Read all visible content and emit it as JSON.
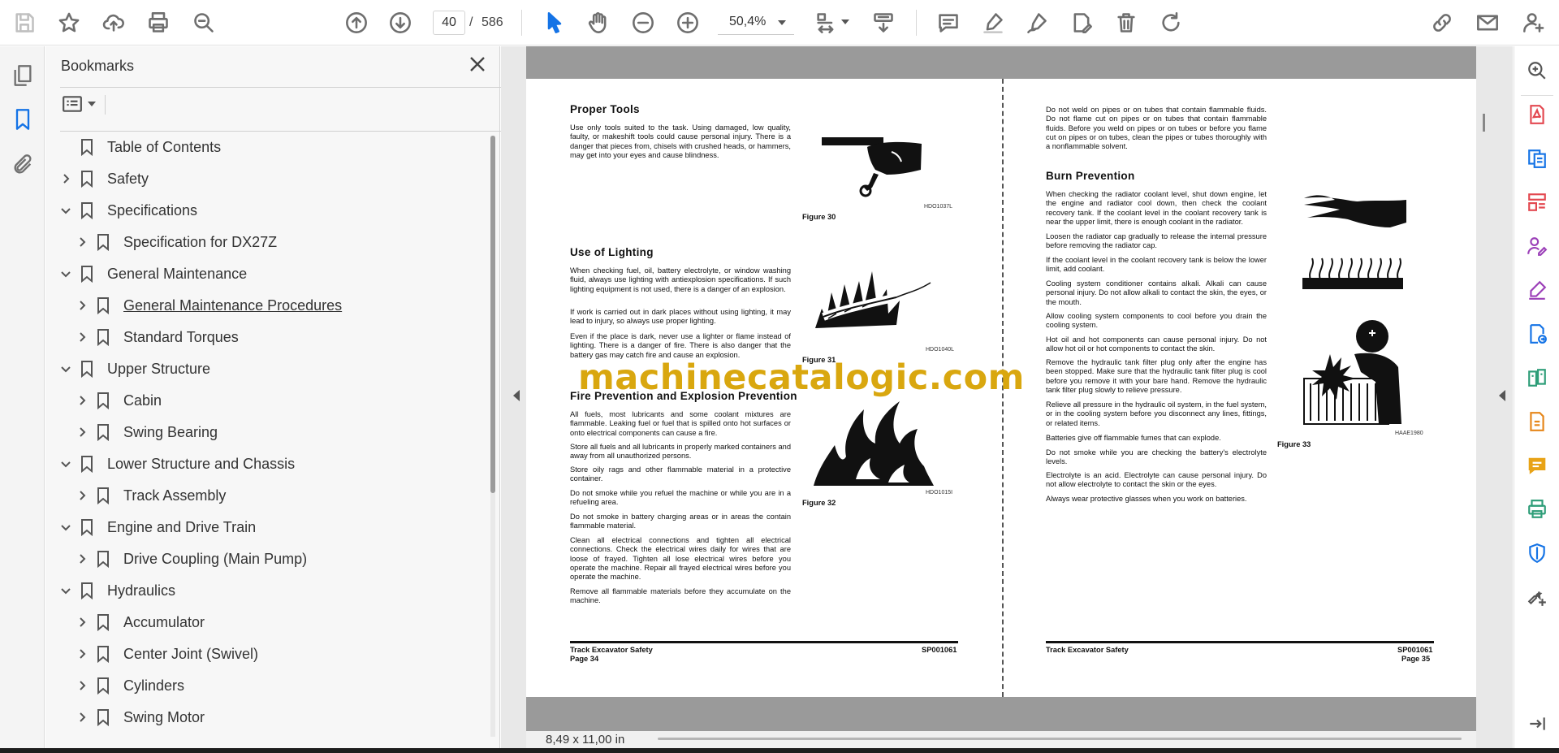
{
  "toolbar": {
    "page_current": "40",
    "page_separator": "/",
    "page_total": "586",
    "zoom": "50,4%",
    "icons": [
      "save-icon",
      "star-icon",
      "upload-icon",
      "print-icon",
      "zoom-search-icon",
      "page-up-icon",
      "page-down-icon",
      "select-arrow-icon",
      "hand-icon",
      "zoom-out-icon",
      "zoom-in-icon",
      "fit-page-icon",
      "scroll-mode-icon",
      "comment-icon",
      "highlight-icon",
      "sign-icon",
      "edit-pdf-icon",
      "delete-icon",
      "rotate-icon",
      "share-link-icon",
      "mail-icon",
      "add-user-icon"
    ]
  },
  "bookmarks": {
    "title": "Bookmarks",
    "items": [
      {
        "label": "Table of Contents",
        "level": 0,
        "chevron": "none"
      },
      {
        "label": "Safety",
        "level": 0,
        "chevron": "right"
      },
      {
        "label": "Specifications",
        "level": 0,
        "chevron": "down"
      },
      {
        "label": "Specification for DX27Z",
        "level": 1,
        "chevron": "right"
      },
      {
        "label": "General Maintenance",
        "level": 0,
        "chevron": "down"
      },
      {
        "label": "General Maintenance Procedures",
        "level": 1,
        "chevron": "right",
        "hover": true
      },
      {
        "label": "Standard Torques",
        "level": 1,
        "chevron": "right"
      },
      {
        "label": "Upper Structure",
        "level": 0,
        "chevron": "down"
      },
      {
        "label": "Cabin",
        "level": 1,
        "chevron": "right"
      },
      {
        "label": "Swing Bearing",
        "level": 1,
        "chevron": "right"
      },
      {
        "label": "Lower Structure and Chassis",
        "level": 0,
        "chevron": "down"
      },
      {
        "label": "Track Assembly",
        "level": 1,
        "chevron": "right"
      },
      {
        "label": "Engine and Drive Train",
        "level": 0,
        "chevron": "down"
      },
      {
        "label": "Drive Coupling (Main Pump)",
        "level": 1,
        "chevron": "right"
      },
      {
        "label": "Hydraulics",
        "level": 0,
        "chevron": "down"
      },
      {
        "label": "Accumulator",
        "level": 1,
        "chevron": "right"
      },
      {
        "label": "Center Joint (Swivel)",
        "level": 1,
        "chevron": "right"
      },
      {
        "label": "Cylinders",
        "level": 1,
        "chevron": "right"
      },
      {
        "label": "Swing Motor",
        "level": 1,
        "chevron": "right"
      }
    ]
  },
  "left_page": {
    "s1_title": "Proper Tools",
    "s1_p1": "Use only tools suited to the task. Using damaged, low quality, faulty, or makeshift tools could cause personal injury. There is a danger that pieces from, chisels with crushed heads, or hammers, may get into your eyes and cause blindness.",
    "fig30_code": "HDO1037L",
    "fig30": "Figure 30",
    "s2_title": "Use of Lighting",
    "s2_p1": "When checking fuel, oil, battery electrolyte, or window washing fluid, always use lighting with antiexplosion specifications. If such lighting equipment is not used, there is a danger of an explosion.",
    "s2_p2": "If work is carried out in dark places without using lighting, it may lead to injury, so always use proper lighting.",
    "s2_p3": "Even if the place is dark, never use a lighter or flame instead of lighting. There is a danger of fire. There is also danger that the battery gas may catch fire and cause an explosion.",
    "fig31_code": "HDO1040L",
    "fig31": "Figure 31",
    "s3_title": "Fire Prevention and Explosion Prevention",
    "s3_p1": "All fuels, most lubricants and some coolant mixtures are flammable. Leaking fuel or fuel that is spilled onto hot surfaces or onto electrical components can cause a fire.",
    "s3_p2": "Store all fuels and all lubricants in properly marked containers and away from all unauthorized persons.",
    "s3_p3": "Store oily rags and other flammable material in a protective container.",
    "s3_p4": "Do not smoke while you refuel the machine or while you are in a refueling area.",
    "s3_p5": "Do not smoke in battery charging areas or in areas the contain flammable material.",
    "s3_p6": "Clean all electrical connections and tighten all electrical connections. Check the electrical wires daily for wires that are loose of frayed. Tighten all lose electrical wires before you operate the machine. Repair all frayed electrical wires before you operate the machine.",
    "s3_p7": "Remove all flammable materials before they accumulate on the machine.",
    "fig32_code": "HDO1015I",
    "fig32": "Figure 32",
    "footer_left": "Track Excavator Safety",
    "footer_page": "Page 34",
    "footer_code": "SP001061"
  },
  "right_page": {
    "p0": "Do not weld on pipes or on tubes that contain flammable fluids. Do not flame cut on pipes or on tubes that contain flammable fluids. Before you weld on pipes or on tubes or before you flame cut on pipes or on tubes, clean the pipes or tubes thoroughly with a nonflammable solvent.",
    "s4_title": "Burn Prevention",
    "s4_p1": "When checking the radiator coolant level, shut down engine, let the engine and radiator cool down, then check the coolant recovery tank. If the coolant level in the coolant recovery tank is near the upper limit, there is enough coolant in the radiator.",
    "s4_p2": "Loosen the radiator cap gradually to release the internal pressure before removing the radiator cap.",
    "s4_p3": "If the coolant level in the coolant recovery tank is below the lower limit, add coolant.",
    "s4_p4": "Cooling system conditioner contains alkali. Alkali can cause personal injury. Do not allow alkali to contact the skin, the eyes, or the mouth.",
    "s4_p5": "Allow cooling system components to cool before you drain the cooling system.",
    "s4_p6": "Hot oil and hot components can cause personal injury. Do not allow hot oil or hot components to contact the skin.",
    "s4_p7": "Remove the hydraulic tank filter plug only after the engine has been stopped. Make sure that the hydraulic tank filter plug is cool before you remove it with your bare hand. Remove the hydraulic tank filter plug slowly to relieve pressure.",
    "s4_p8": "Relieve all pressure in the hydraulic oil system, in the fuel system, or in the cooling system before you disconnect any lines, fittings, or related items.",
    "s4_p9": "Batteries give off flammable fumes that can explode.",
    "s4_p10": "Do not smoke while you are checking the battery's electrolyte levels.",
    "s4_p11": "Electrolyte is an acid. Electrolyte can cause personal injury. Do not allow electrolyte to contact the skin or the eyes.",
    "s4_p12": "Always wear protective glasses when you work on batteries.",
    "fig33_code": "HAAE1980",
    "fig33": "Figure 33",
    "footer_left": "Track Excavator Safety",
    "footer_page": "Page 35",
    "footer_code": "SP001061"
  },
  "watermark": "machinecatalogic.com",
  "status": {
    "page_size": "8,49 x 11,00 in"
  },
  "colors": {
    "accent": "#1473e6",
    "watermark": "#d9a70f",
    "doc_gray": "#9a9a9a"
  }
}
